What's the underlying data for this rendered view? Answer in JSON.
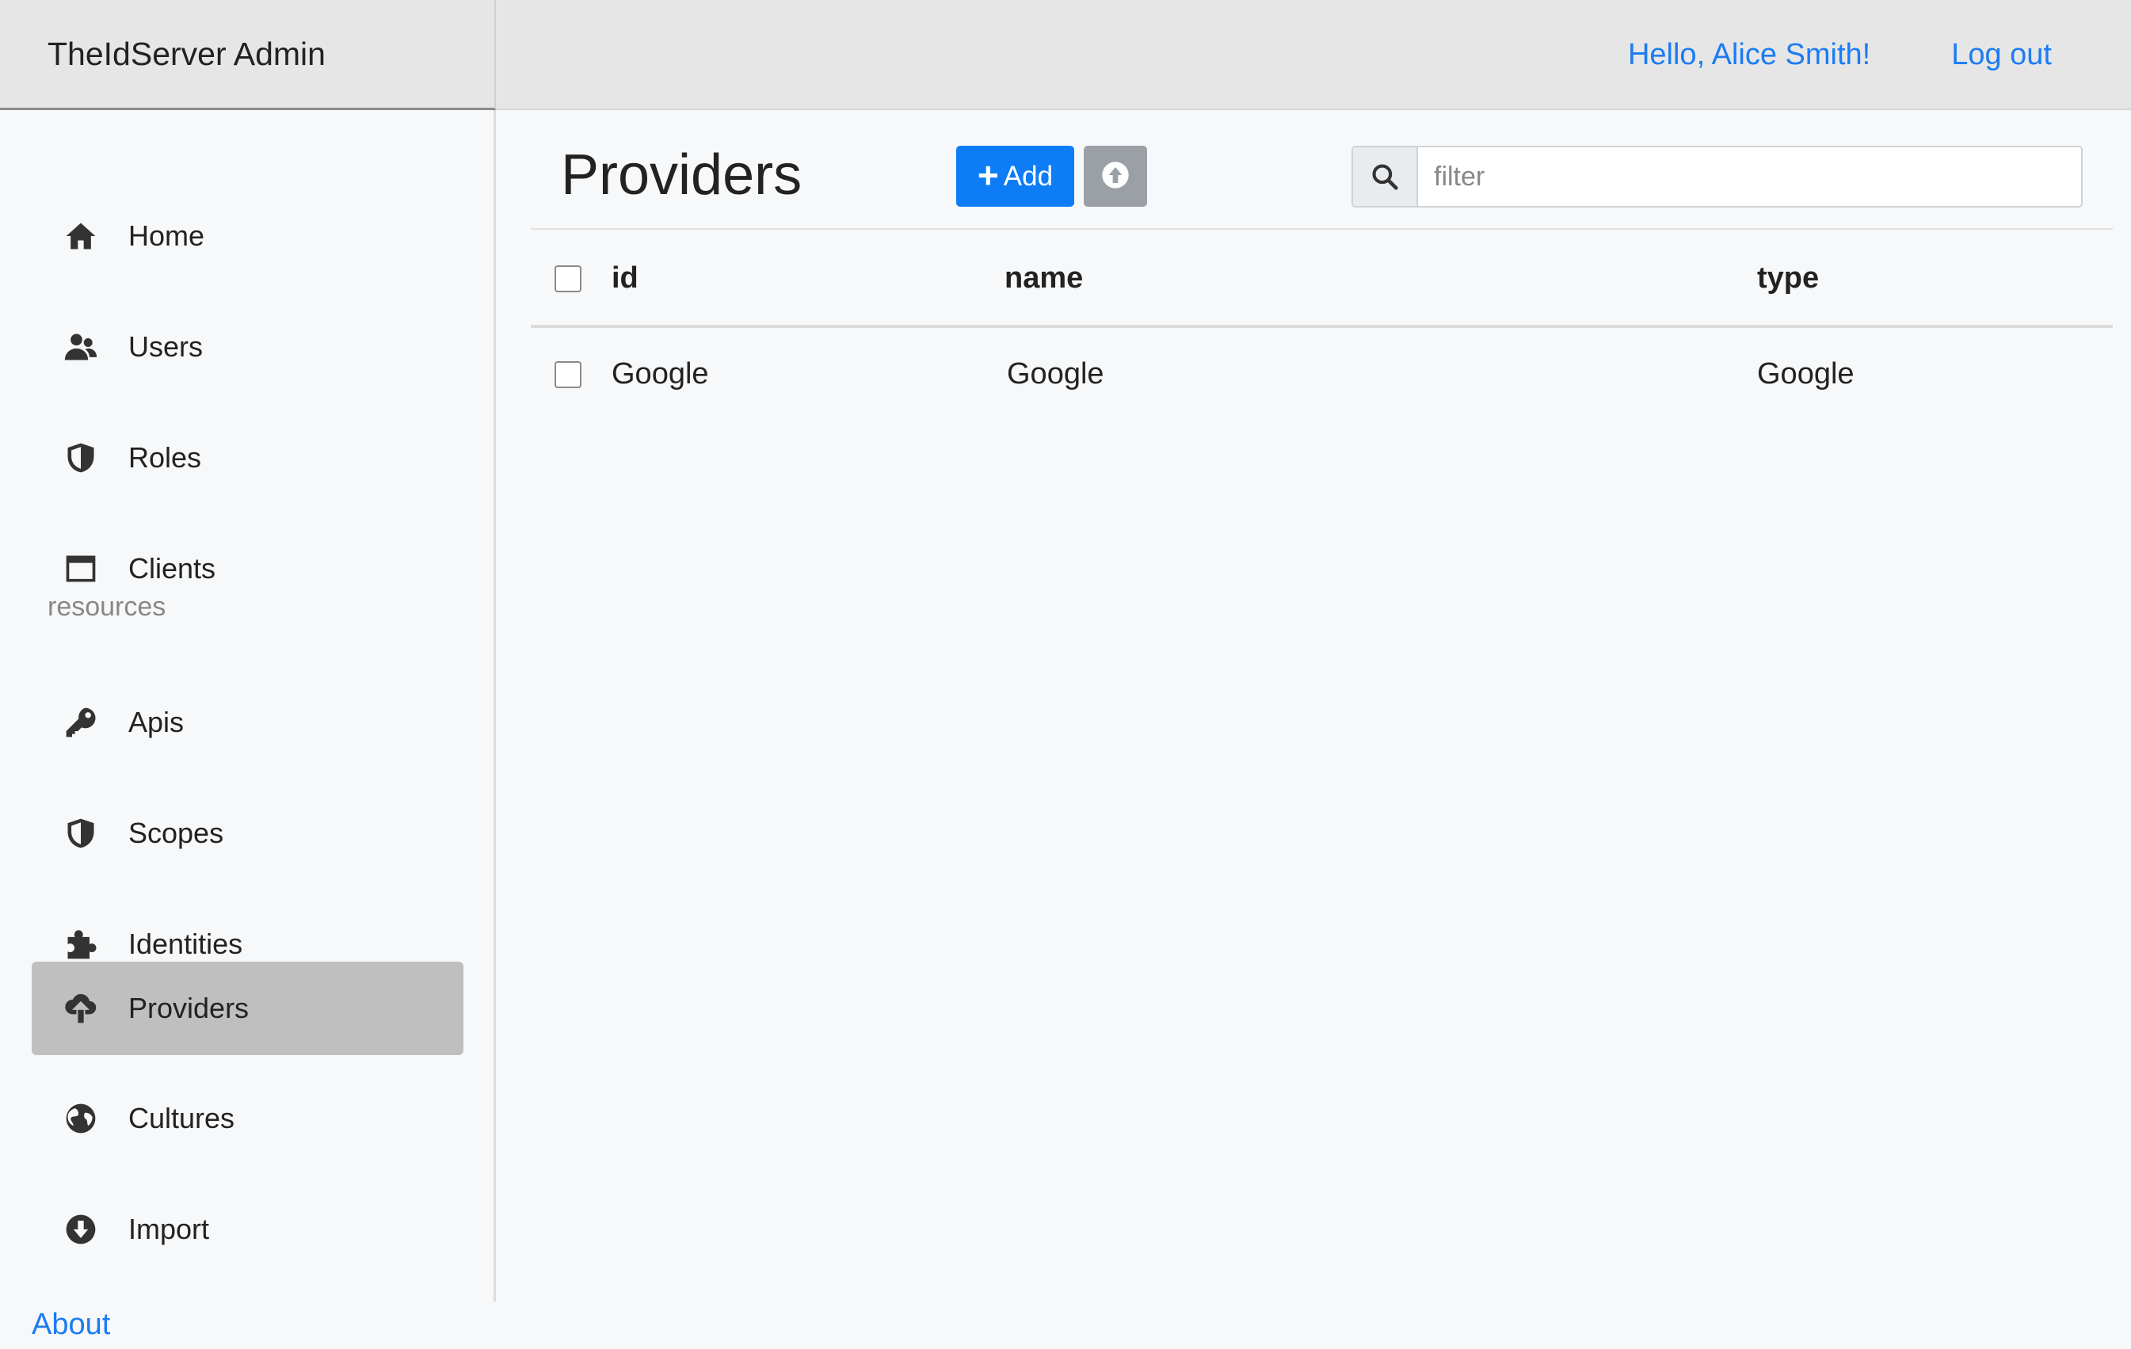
{
  "header": {
    "brand": "TheIdServer Admin",
    "greeting": "Hello, Alice Smith!",
    "logout": "Log out"
  },
  "sidebar": {
    "items": [
      {
        "label": "Home",
        "icon": "home-icon"
      },
      {
        "label": "Users",
        "icon": "users-icon"
      },
      {
        "label": "Roles",
        "icon": "shield-icon"
      },
      {
        "label": "Clients",
        "icon": "window-icon"
      },
      {
        "label": "Apis",
        "icon": "key-icon"
      },
      {
        "label": "Scopes",
        "icon": "shield-icon"
      },
      {
        "label": "Identities",
        "icon": "puzzle-icon"
      },
      {
        "label": "Providers",
        "icon": "cloud-upload-icon",
        "active": true
      },
      {
        "label": "Cultures",
        "icon": "globe-icon"
      },
      {
        "label": "Import",
        "icon": "arrow-circle-down-icon"
      }
    ],
    "section_label": "resources",
    "about": "About"
  },
  "main": {
    "title": "Providers",
    "add_label": "Add",
    "upload_icon": "arrow-circle-up-icon",
    "search": {
      "placeholder": "filter",
      "value": ""
    },
    "table": {
      "columns": [
        "id",
        "name",
        "type"
      ],
      "rows": [
        {
          "id": "Google",
          "name": "Google",
          "type": "Google"
        }
      ]
    }
  },
  "colors": {
    "accent": "#0d7cf5",
    "link": "#1c7cf2",
    "active_nav": "#bfbfbf",
    "header_bg": "#e6e6e6"
  }
}
